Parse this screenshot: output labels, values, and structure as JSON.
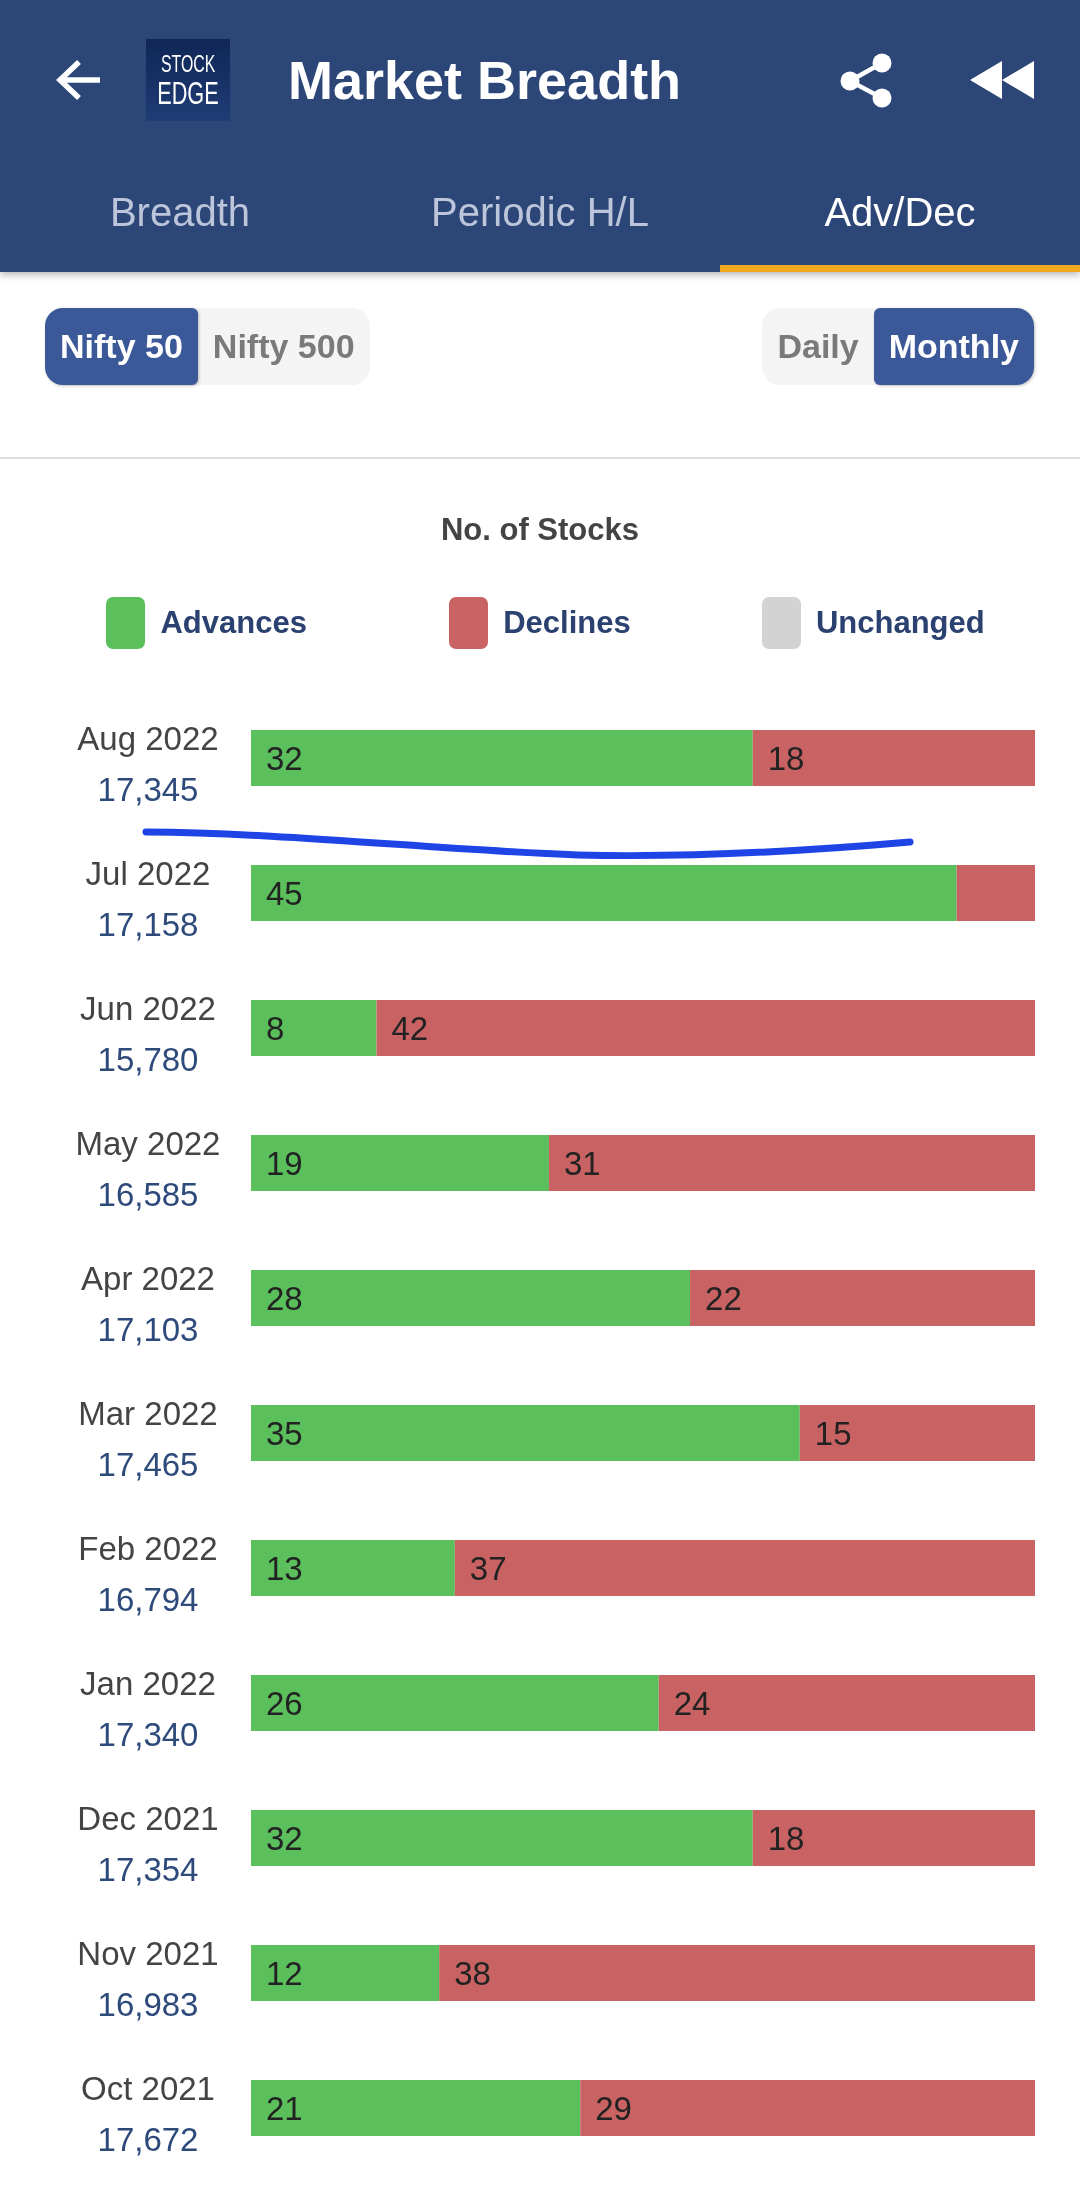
{
  "header": {
    "logo": [
      "STOCK",
      "EDGE"
    ],
    "title": "Market Breadth"
  },
  "tabs": [
    {
      "label": "Breadth",
      "selected": false
    },
    {
      "label": "Periodic H/L",
      "selected": false
    },
    {
      "label": "Adv/Dec",
      "selected": true
    }
  ],
  "index_toggle": [
    {
      "label": "Nifty 50",
      "selected": true
    },
    {
      "label": "Nifty 500",
      "selected": false
    }
  ],
  "period_toggle": [
    {
      "label": "Daily",
      "selected": false
    },
    {
      "label": "Monthly",
      "selected": true
    }
  ],
  "chart": {
    "chart_data": {
      "type": "bar",
      "title": "No. of Stocks",
      "orientation": "horizontal",
      "stacked": true,
      "legend": "top",
      "categories": [
        "Aug 2022",
        "Jul 2022",
        "Jun 2022",
        "May 2022",
        "Apr 2022",
        "Mar 2022",
        "Feb 2022",
        "Jan 2022",
        "Dec 2021",
        "Nov 2021",
        "Oct 2021"
      ],
      "series": [
        {
          "name": "Advances",
          "color": "#5bbf5c",
          "values": [
            32,
            45,
            8,
            19,
            28,
            35,
            13,
            26,
            32,
            12,
            21
          ],
          "value_labels": [
            "32",
            "45",
            "8",
            "19",
            "28",
            "35",
            "13",
            "26",
            "32",
            "12",
            "21"
          ]
        },
        {
          "name": "Declines",
          "color": "#c96262",
          "values": [
            18,
            5,
            42,
            31,
            22,
            15,
            37,
            24,
            18,
            38,
            29
          ],
          "value_labels": [
            "18",
            null,
            "42",
            "31",
            "22",
            "15",
            "37",
            "24",
            "18",
            "38",
            "29"
          ]
        },
        {
          "name": "Unchanged",
          "color": "#d3d3d3",
          "values": [
            0,
            0,
            0,
            0,
            0,
            0,
            0,
            0,
            0,
            0,
            0
          ],
          "value_labels": [
            null,
            null,
            null,
            null,
            null,
            null,
            null,
            null,
            null,
            null,
            null
          ]
        }
      ]
    },
    "index_levels": [
      "17,345",
      "17,158",
      "15,780",
      "16,585",
      "17,103",
      "17,465",
      "16,794",
      "17,340",
      "17,354",
      "16,983",
      "17,672"
    ]
  }
}
